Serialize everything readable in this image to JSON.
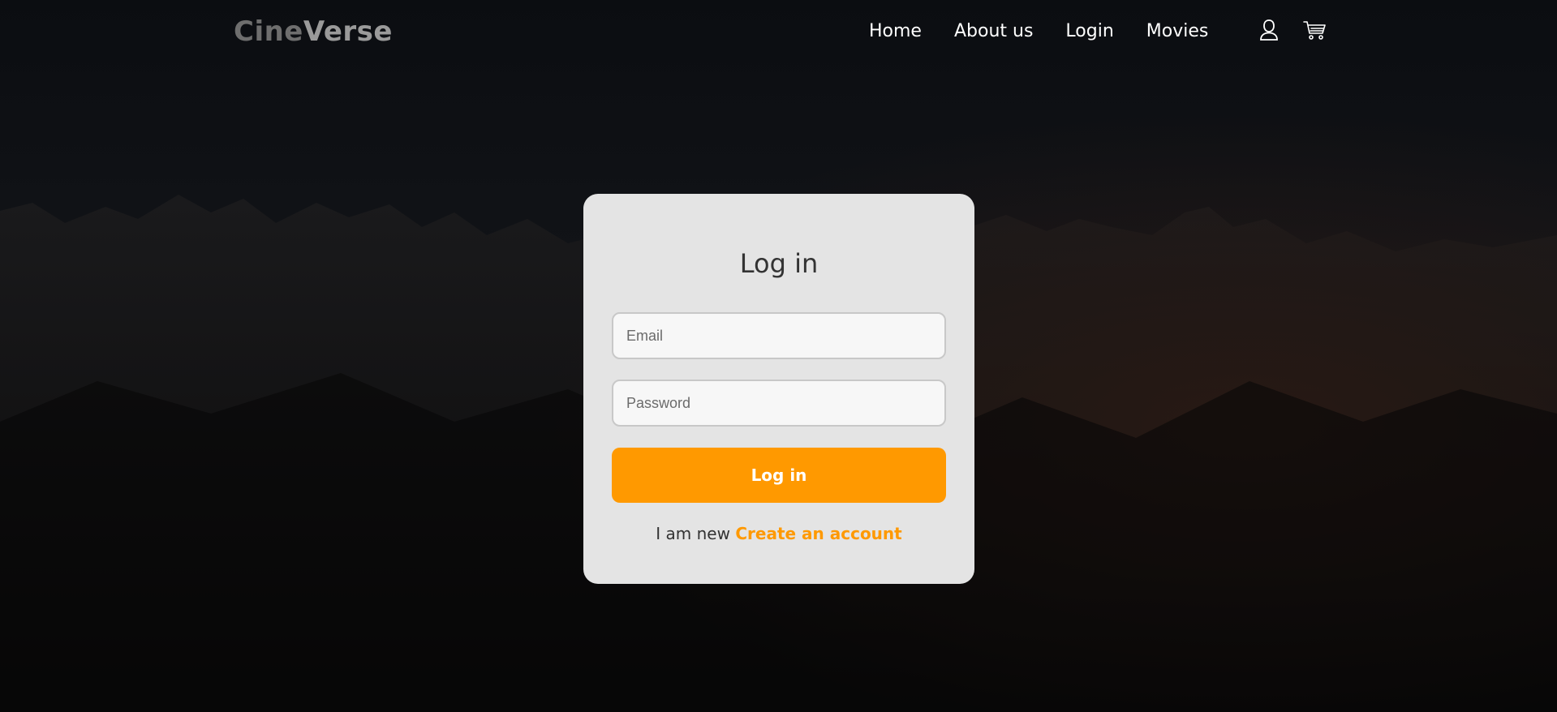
{
  "brand": {
    "part1": "Cine",
    "part2": "Verse"
  },
  "nav": {
    "items": [
      {
        "label": "Home"
      },
      {
        "label": "About us"
      },
      {
        "label": "Login"
      },
      {
        "label": "Movies"
      }
    ],
    "icons": [
      "user-icon",
      "cart-icon"
    ]
  },
  "login_card": {
    "title": "Log in",
    "email_placeholder": "Email",
    "password_placeholder": "Password",
    "submit_label": "Log in",
    "signup_prefix": "I am new",
    "signup_link": "Create an account"
  },
  "colors": {
    "accent": "#ff9900",
    "card_background": "#e4e4e4",
    "page_background": "#0b0c0f"
  }
}
